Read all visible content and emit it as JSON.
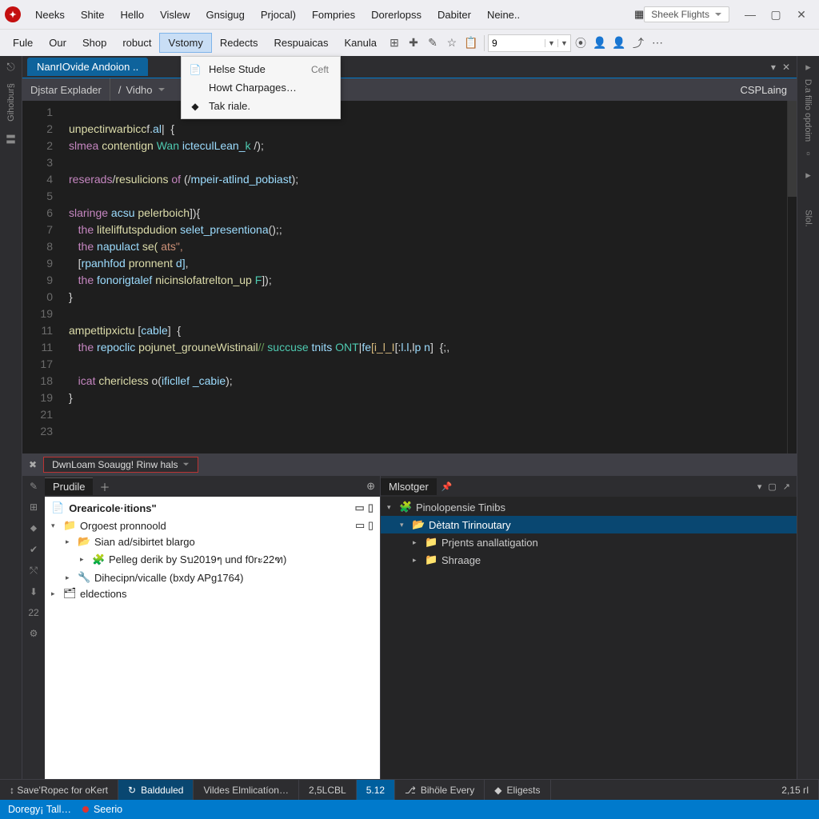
{
  "titlebar": {
    "menus": [
      "Neeks",
      "Shite",
      "Hello",
      "Vislew",
      "Gnsigug",
      "Prjocal)",
      "Fompries",
      "Dorerlopss",
      "Dabiter",
      "Neine.."
    ],
    "sheek": "Sheek Flights"
  },
  "toolbar2": {
    "menus": [
      "Fule",
      "Our",
      "Shop",
      "robuct",
      "Vstomy",
      "Redects",
      "Respuaicas",
      "Kanula"
    ],
    "open_index": 4,
    "combo_value": "9"
  },
  "dropdown": {
    "items": [
      {
        "icon": "📄",
        "label": "Helse Stude",
        "shortcut": "Ceft"
      },
      {
        "icon": "",
        "label": "Howt Charpages…",
        "shortcut": ""
      },
      {
        "icon": "◆",
        "label": "Tak riale.",
        "shortcut": ""
      }
    ]
  },
  "doctab": {
    "label": "NanrIOvide Andoion .."
  },
  "navbar": {
    "a": "Djstar Explader",
    "b": "Vidho",
    "r": "CSPLaing"
  },
  "gutter": [
    "1",
    "2",
    "2",
    "3",
    "4",
    "5",
    "6",
    "7",
    "8",
    "9",
    "9",
    "0",
    "19",
    "11",
    "11",
    "17",
    "18",
    "19",
    "21",
    "23"
  ],
  "code": [
    [],
    [
      {
        "t": "unpectirwarbicc",
        "c": "fn"
      },
      {
        "t": "f.",
        "c": "op"
      },
      {
        "t": "al",
        "c": "id"
      },
      {
        "t": "|  {",
        "c": "op"
      }
    ],
    [
      {
        "t": "slmea ",
        "c": "kw"
      },
      {
        "t": "contentign ",
        "c": "fn"
      },
      {
        "t": "Wan ",
        "c": "ty"
      },
      {
        "t": "icteculLean_",
        "c": "id"
      },
      {
        "t": "k ",
        "c": "ty"
      },
      {
        "t": "/);",
        "c": "op"
      }
    ],
    [],
    [
      {
        "t": "reserads",
        "c": "kw"
      },
      {
        "t": "/",
        "c": "op"
      },
      {
        "t": "resulicions ",
        "c": "fn"
      },
      {
        "t": "of ",
        "c": "kw"
      },
      {
        "t": "(/",
        "c": "op"
      },
      {
        "t": "mpeir-atlind_pobiast",
        "c": "id"
      },
      {
        "t": ");",
        "c": "op"
      }
    ],
    [],
    [
      {
        "t": "slaringe ",
        "c": "kw"
      },
      {
        "t": "acsu ",
        "c": "id"
      },
      {
        "t": "pelerboich",
        "c": "fn"
      },
      {
        "t": "]){",
        "c": "op"
      }
    ],
    [
      {
        "t": "   the ",
        "c": "kw"
      },
      {
        "t": "liteliffutspdudion ",
        "c": "fn"
      },
      {
        "t": "selet_presentiona",
        "c": "id"
      },
      {
        "t": "();;",
        "c": "op"
      }
    ],
    [
      {
        "t": "   the ",
        "c": "kw"
      },
      {
        "t": "napulact ",
        "c": "id"
      },
      {
        "t": "se( ",
        "c": "fn"
      },
      {
        "t": "ats\",",
        "c": "str"
      },
      {
        "t": "",
        "c": "op"
      }
    ],
    [
      {
        "t": "   [",
        "c": "op"
      },
      {
        "t": "rpanhfod ",
        "c": "id"
      },
      {
        "t": "pronnent ",
        "c": "fn"
      },
      {
        "t": "d]",
        "c": "id"
      },
      {
        "t": ",",
        "c": "op"
      }
    ],
    [
      {
        "t": "   the ",
        "c": "kw"
      },
      {
        "t": "fonorigtalef ",
        "c": "id"
      },
      {
        "t": "nicinslofatrelton_up ",
        "c": "fn"
      },
      {
        "t": "F",
        "c": "ty"
      },
      {
        "t": "]);",
        "c": "op"
      }
    ],
    [
      {
        "t": "}",
        "c": "op"
      }
    ],
    [],
    [
      {
        "t": "ampettipxictu ",
        "c": "fn"
      },
      {
        "t": "[",
        "c": "op"
      },
      {
        "t": "cable",
        "c": "id"
      },
      {
        "t": "]  {",
        "c": "op"
      }
    ],
    [
      {
        "t": "   the ",
        "c": "kw"
      },
      {
        "t": "repoclic ",
        "c": "id"
      },
      {
        "t": "pojunet_grouneWistinail",
        "c": "fn"
      },
      {
        "t": "// ",
        "c": "cm"
      },
      {
        "t": "succuse ",
        "c": "ty"
      },
      {
        "t": "tnits ",
        "c": "id"
      },
      {
        "t": "ONT",
        "c": "ty"
      },
      {
        "t": "|",
        "c": "op"
      },
      {
        "t": "fe",
        "c": "id"
      },
      {
        "t": "[i_l_I",
        "c": "tok-y"
      },
      {
        "t": "[:",
        "c": "op"
      },
      {
        "t": "l.l",
        "c": "id"
      },
      {
        "t": ",l",
        "c": "op"
      },
      {
        "t": "p n",
        "c": "id"
      },
      {
        "t": "]  {;,",
        "c": "op"
      }
    ],
    [],
    [
      {
        "t": "   icat ",
        "c": "kw"
      },
      {
        "t": "chericless ",
        "c": "fn"
      },
      {
        "t": "o(",
        "c": "op"
      },
      {
        "t": "ificllef _cabie",
        "c": "id"
      },
      {
        "t": ");",
        "c": "op"
      }
    ],
    [
      {
        "t": "}",
        "c": "op"
      }
    ],
    [],
    []
  ],
  "dbg": {
    "label": "DwnLoam Soaugg! Rinw hals"
  },
  "paneL": {
    "tab": "Prudile",
    "header": "Orearicole·itions\"",
    "rows": [
      {
        "d": 0,
        "caret": "▾",
        "icon": "📁",
        "label": "Orgoest pronnoold",
        "tail": true
      },
      {
        "d": 1,
        "caret": "▸",
        "icon": "📂",
        "label": "Sian ad/sibirtet blargo"
      },
      {
        "d": 2,
        "caret": "▸",
        "icon": "🧩",
        "label": "Pelleg derik by Sบ2019ๆ und f0rะ22ฑ)"
      },
      {
        "d": 1,
        "caret": "▸",
        "icon": "🔧",
        "label": "Dihecipn/vicalle (bxdy APg1764)"
      },
      {
        "d": 0,
        "caret": "▸",
        "icon": "🗂",
        "label": "eldections"
      }
    ]
  },
  "paneR": {
    "tab": "Mlsotger",
    "rows": [
      {
        "d": 0,
        "caret": "▾",
        "icon": "🧩",
        "label": "Pinolopensie Tinibs",
        "sel": false
      },
      {
        "d": 1,
        "caret": "▾",
        "icon": "📂",
        "label": "Dètatn Tirinoutary",
        "sel": true,
        "cls": "folder-y"
      },
      {
        "d": 2,
        "caret": "▸",
        "icon": "📁",
        "label": "Prjents anallatigation",
        "cls": "folder-b"
      },
      {
        "d": 2,
        "caret": "▸",
        "icon": "📁",
        "label": "Shraage",
        "cls": "folder-b"
      }
    ]
  },
  "status": {
    "a": "↕ Save'Ropec for oKert",
    "b": "Baldduled",
    "c": "Vildes Elmlicatíon…",
    "d": "2,5LCBL",
    "e": "5.12",
    "f": "Bihöle Every",
    "g": "Eligests",
    "h": "2,15 гl"
  },
  "footer": {
    "a": "Doregy¡ Tall…",
    "b": "Seerio"
  }
}
